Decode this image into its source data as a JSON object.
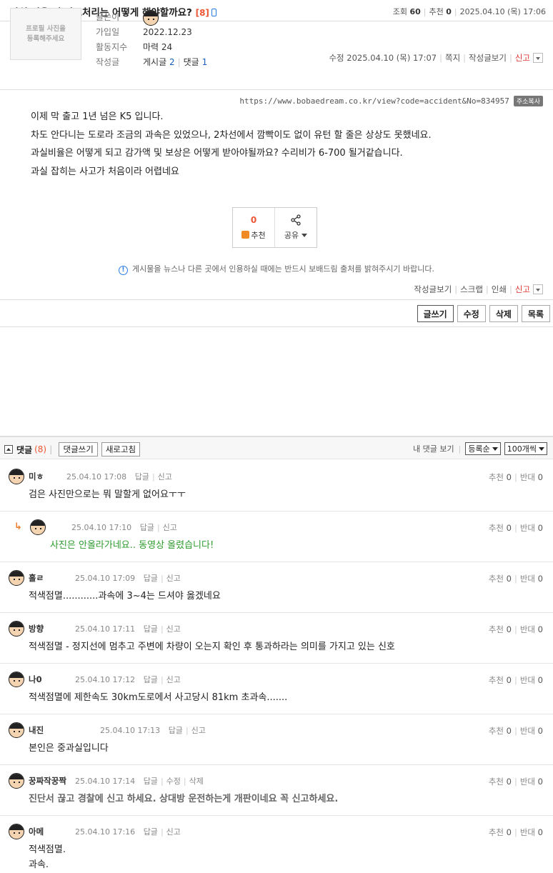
{
  "post": {
    "title": "과실 비율 및 사고처리는 어떻게 해야할까요?",
    "comment_count": "[8]",
    "views_label": "조회",
    "views": "60",
    "recommend_label": "추천",
    "recommend": "0",
    "date": "2025.04.10 (목) 17:06"
  },
  "profile": {
    "photo_placeholder": "프로필 사진을\n등록해주세요",
    "labels": [
      "글쓴이",
      "가입일",
      "활동지수",
      "작성글"
    ],
    "join_date": "2022.12.23",
    "activity": "마력 24",
    "posts_label": "게시글",
    "posts_count": "2",
    "replies_label": "댓글",
    "replies_count": "1"
  },
  "post_actions": {
    "modified": "수정 2025.04.10 (목) 17:07",
    "message": "쪽지",
    "view_posts": "작성글보기",
    "report": "신고"
  },
  "url": {
    "text": "https://www.bobaedream.co.kr/view?code=accident&No=834957",
    "copy_label": "주소복사"
  },
  "content": {
    "lines": [
      "이제 막 출고 1년 넘은 K5 입니다.",
      "차도 안다니는 도로라 조금의 과속은 있었으나, 2차선에서 깜빡이도 없이 유턴 할 줄은 상상도 못했네요.",
      "과실비율은 어떻게 되고 감가액 및 보상은 어떻게 받아야될까요? 수리비가 6-700 될거같습니다.",
      "과실 잡히는 사고가 처음이라 어렵네요"
    ]
  },
  "recommend_box": {
    "count": "0",
    "recommend_label": "추천",
    "share_label": "공유"
  },
  "notice": "게시물을 뉴스나 다른 곳에서 인용하실 때에는 반드시 보배드림 출처를 밝혀주시기 바랍니다.",
  "bottom_actions": {
    "view_posts": "작성글보기",
    "scrap": "스크랩",
    "print": "인쇄",
    "report": "신고"
  },
  "board_buttons": {
    "write": "글쓰기",
    "edit": "수정",
    "delete": "삭제",
    "list": "목록"
  },
  "comments_header": {
    "label": "댓글",
    "count": "(8)",
    "write": "댓글쓰기",
    "refresh": "새로고침",
    "my_comments": "내 댓글 보기",
    "sort": "등록순",
    "per_page": "100개씩"
  },
  "comments": [
    {
      "nick": "미ㅎ",
      "meta": "25.04.10 17:08",
      "actions": [
        "답글",
        "신고"
      ],
      "rec": "0",
      "opp": "0",
      "lines": [
        "검은 사진만으로는 뭐 말할게 없어요ㅜㅜ"
      ]
    },
    {
      "nick": "",
      "meta": "25.04.10 17:10",
      "actions": [
        "답글",
        "신고"
      ],
      "rec": "0",
      "opp": "0",
      "lines": [
        "사진은 안올라가네요.. 동영상 올렸습니다!"
      ],
      "reply": true
    },
    {
      "nick": "홀ㄹ",
      "meta": "25.04.10 17:09",
      "actions": [
        "답글",
        "신고"
      ],
      "rec": "0",
      "opp": "0",
      "lines": [
        "적색점멸............과속에 3~4는 드셔야 옳겠네요"
      ]
    },
    {
      "nick": "방향",
      "meta": "25.04.10 17:11",
      "actions": [
        "답글",
        "신고"
      ],
      "rec": "0",
      "opp": "0",
      "lines": [
        "적색점멸 - 정지선에 멈추고 주변에 차량이 오는지 확인 후 통과하라는 의미를 가지고 있는 신호"
      ]
    },
    {
      "nick": "나0",
      "meta": "25.04.10 17:12",
      "actions": [
        "답글",
        "신고"
      ],
      "rec": "0",
      "opp": "0",
      "lines": [
        "적색점멸에 제한속도 30km도로에서 사고당시 81km 초과속......."
      ]
    },
    {
      "nick": "내진",
      "meta": "25.04.10 17:13",
      "actions": [
        "답글",
        "신고"
      ],
      "rec": "0",
      "opp": "0",
      "lines": [
        "본인은 중과실입니다"
      ]
    },
    {
      "nick": "꿍짜작꿍짝",
      "meta": "25.04.10 17:14",
      "actions": [
        "답글",
        "수정",
        "삭제"
      ],
      "rec": "0",
      "opp": "0",
      "lines": [
        "진단서 끊고 경찰에 신고 하세요. 상대방 운전하는게 개판이네요 꼭 신고하세요."
      ]
    },
    {
      "nick": "아메",
      "meta": "25.04.10 17:16",
      "actions": [
        "답글",
        "신고"
      ],
      "rec": "0",
      "opp": "0",
      "lines": [
        "적색점멸.",
        "과속."
      ]
    }
  ],
  "vote_labels": {
    "rec": "추천",
    "opp": "반대"
  }
}
